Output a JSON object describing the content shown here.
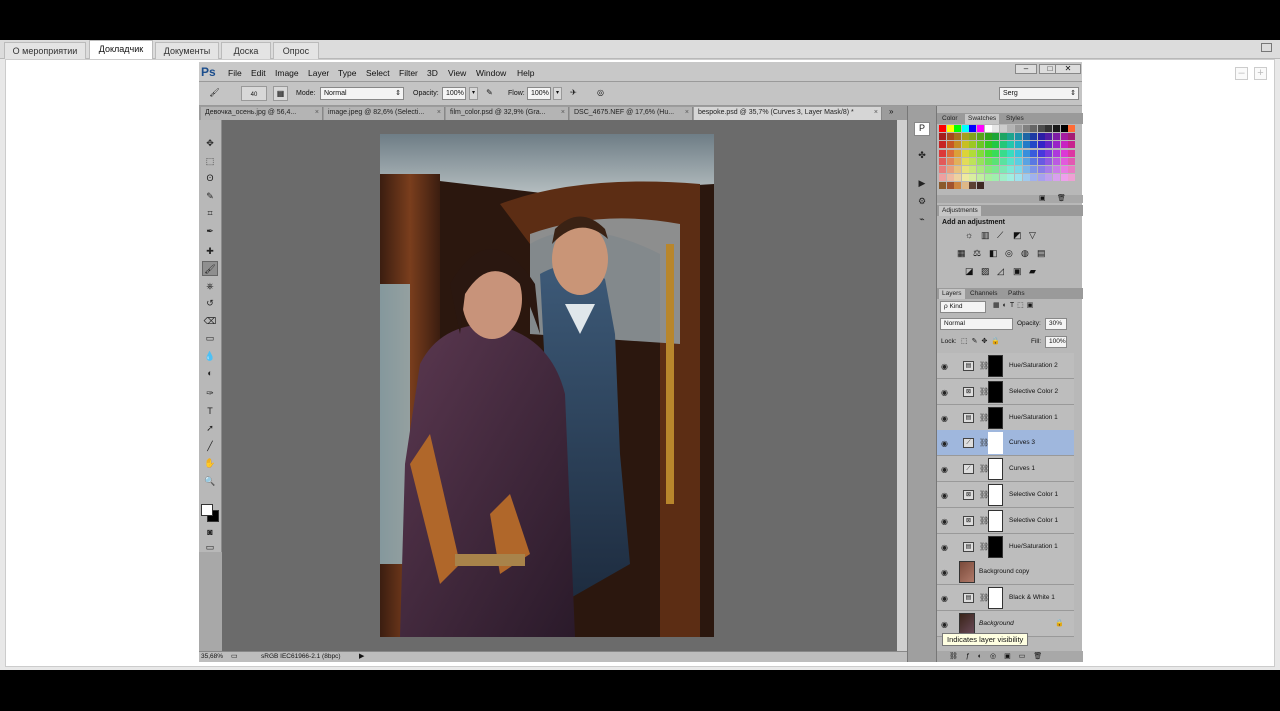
{
  "browser": {
    "tabs": [
      "О мероприятии",
      "Докладчик",
      "Документы",
      "Доска",
      "Опрос"
    ],
    "active_tab": 1
  },
  "photoshop": {
    "logo": "Ps",
    "menu": [
      "File",
      "Edit",
      "Image",
      "Layer",
      "Type",
      "Select",
      "Filter",
      "3D",
      "View",
      "Window",
      "Help"
    ],
    "window_controls": [
      "–",
      "□",
      "✕"
    ],
    "options": {
      "brush_size": "40",
      "mode_label": "Mode:",
      "mode_value": "Normal",
      "opacity_label": "Opacity:",
      "opacity_value": "100%",
      "flow_label": "Flow:",
      "flow_value": "100%",
      "workspace": "Serg"
    },
    "doc_tabs": [
      "Девочка_осень.jpg @ 56,4...",
      "image.jpeg @ 82,6% (Selecti...",
      "film_color.psd @ 32,9% (Gra...",
      "DSC_4675.NEF @ 17,6% (Hu...",
      "bespoke.psd @ 35,7% (Curves 3, Layer Mask/8) *"
    ],
    "tools": [
      "move-tool",
      "marquee-tool",
      "lasso-tool",
      "quick-select-tool",
      "crop-tool",
      "eyedropper-tool",
      "healing-tool",
      "brush-tool",
      "stamp-tool",
      "history-brush-tool",
      "eraser-tool",
      "gradient-tool",
      "blur-tool",
      "dodge-tool",
      "pen-tool",
      "type-tool",
      "path-select-tool",
      "line-tool",
      "hand-tool",
      "zoom-tool"
    ],
    "tool_glyphs": [
      "✥",
      "⬚",
      "ʘ",
      "✎",
      "⌗",
      "✒",
      "✚",
      "🖌",
      "⎈",
      "↺",
      "⌫",
      "▭",
      "💧",
      "◐",
      "✑",
      "T",
      "➚",
      "╱",
      "✋",
      "🔍"
    ],
    "status": {
      "zoom": "35,68%",
      "profile": "sRGB IEC61966-2.1 (8bpc)"
    },
    "panels": {
      "color_tabs": [
        "Color",
        "Swatches",
        "Styles"
      ],
      "adjustments_title": "Adjustments",
      "adjustments_subtitle": "Add an adjustment",
      "layers_tabs": [
        "Layers",
        "Channels",
        "Paths"
      ],
      "kind_label": "ρ Kind",
      "blend_mode": "Normal",
      "opacity_label": "Opacity:",
      "opacity_value": "30%",
      "lock_label": "Lock:",
      "fill_label": "Fill:",
      "fill_value": "100%",
      "layers": [
        {
          "name": "Hue/Saturation 2",
          "mask": "black",
          "selected": false
        },
        {
          "name": "Selective Color 2",
          "mask": "black",
          "selected": false
        },
        {
          "name": "Hue/Saturation 1",
          "mask": "black",
          "selected": false
        },
        {
          "name": "Curves 3",
          "mask": "white",
          "selected": true
        },
        {
          "name": "Curves 1",
          "mask": "white",
          "selected": false
        },
        {
          "name": "Selective Color 1",
          "mask": "white",
          "selected": false
        },
        {
          "name": "Selective Color 1",
          "mask": "white",
          "selected": false
        },
        {
          "name": "Hue/Saturation 1",
          "mask": "black",
          "selected": false
        },
        {
          "name": "Background copy",
          "mask": "photo",
          "selected": false
        },
        {
          "name": "Black & White 1",
          "mask": "white",
          "selected": false
        },
        {
          "name": "Background",
          "mask": "photo",
          "selected": false
        }
      ]
    },
    "tooltip": "Indicates layer visibility"
  }
}
